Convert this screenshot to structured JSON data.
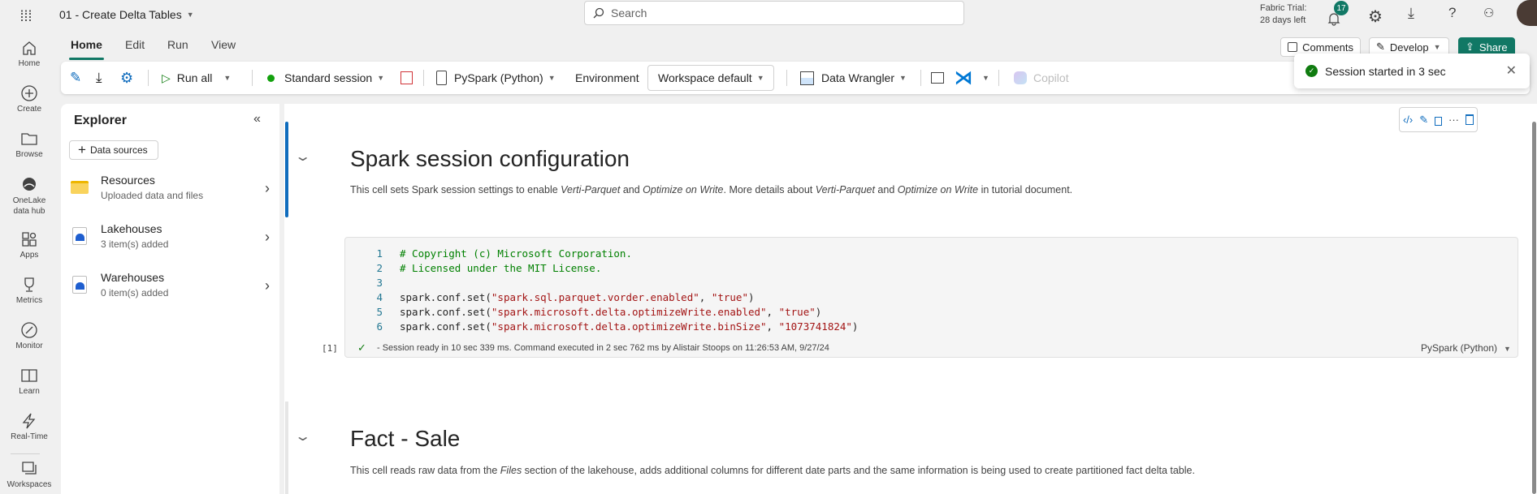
{
  "app": {
    "title": "01 - Create Delta Tables",
    "search_placeholder": "Search",
    "trial_line1": "Fabric Trial:",
    "trial_line2": "28 days left",
    "notification_count": "17"
  },
  "rail": [
    {
      "label": "Home"
    },
    {
      "label": "Create"
    },
    {
      "label": "Browse"
    },
    {
      "label": "OneLake data hub"
    },
    {
      "label": "Apps"
    },
    {
      "label": "Metrics"
    },
    {
      "label": "Monitor"
    },
    {
      "label": "Learn"
    },
    {
      "label": "Real-Time"
    },
    {
      "label": "Workspaces"
    }
  ],
  "tabs": [
    {
      "label": "Home"
    },
    {
      "label": "Edit"
    },
    {
      "label": "Run"
    },
    {
      "label": "View"
    }
  ],
  "toolbar": {
    "run_all": "Run all",
    "session": "Standard session",
    "language": "PySpark (Python)",
    "environment_label": "Environment",
    "environment_value": "Workspace default",
    "data_wrangler": "Data Wrangler",
    "copilot": "Copilot"
  },
  "actions": {
    "comments": "Comments",
    "develop": "Develop",
    "share": "Share"
  },
  "toast": {
    "message": "Session started in 3 sec"
  },
  "explorer": {
    "title": "Explorer",
    "data_sources": "Data sources",
    "items": [
      {
        "title": "Resources",
        "subtitle": "Uploaded data and files"
      },
      {
        "title": "Lakehouses",
        "subtitle": "3 item(s) added"
      },
      {
        "title": "Warehouses",
        "subtitle": "0 item(s) added"
      }
    ]
  },
  "cells": {
    "md1": {
      "heading": "Spark session configuration",
      "p1": "This cell sets Spark session settings to enable ",
      "i1": "Verti-Parquet",
      "p2": " and ",
      "i2": "Optimize on Write",
      "p3": ". More details about ",
      "i3": "Verti-Parquet",
      "p4": " and ",
      "i4": "Optimize on Write",
      "p5": " in tutorial document."
    },
    "code1": {
      "exec_count": "[1]",
      "lines": [
        {
          "n": "1",
          "a": "# Copyright (c) Microsoft Corporation."
        },
        {
          "n": "2",
          "a": "# Licensed under the MIT License."
        },
        {
          "n": "3",
          "a": ""
        },
        {
          "n": "4",
          "a": "spark.conf.set(",
          "b": "\"spark.sql.parquet.vorder.enabled\"",
          "c": ", ",
          "d": "\"true\"",
          "e": ")"
        },
        {
          "n": "5",
          "a": "spark.conf.set(",
          "b": "\"spark.microsoft.delta.optimizeWrite.enabled\"",
          "c": ", ",
          "d": "\"true\"",
          "e": ")"
        },
        {
          "n": "6",
          "a": "spark.conf.set(",
          "b": "\"spark.microsoft.delta.optimizeWrite.binSize\"",
          "c": ", ",
          "d": "\"1073741824\"",
          "e": ")"
        }
      ],
      "status": "- Session ready in 10 sec 339 ms. Command executed in 2 sec 762 ms by Alistair Stoops on 11:26:53 AM, 9/27/24",
      "language": "PySpark (Python)"
    },
    "md2": {
      "heading": "Fact - Sale",
      "p1": "This cell reads raw data from the ",
      "i1": "Files",
      "p2": " section of the lakehouse, adds additional columns for different date parts and the same information is being used to create partitioned fact delta table."
    }
  },
  "colors": {
    "accent": "#117865",
    "blue": "#0f6cbd"
  }
}
